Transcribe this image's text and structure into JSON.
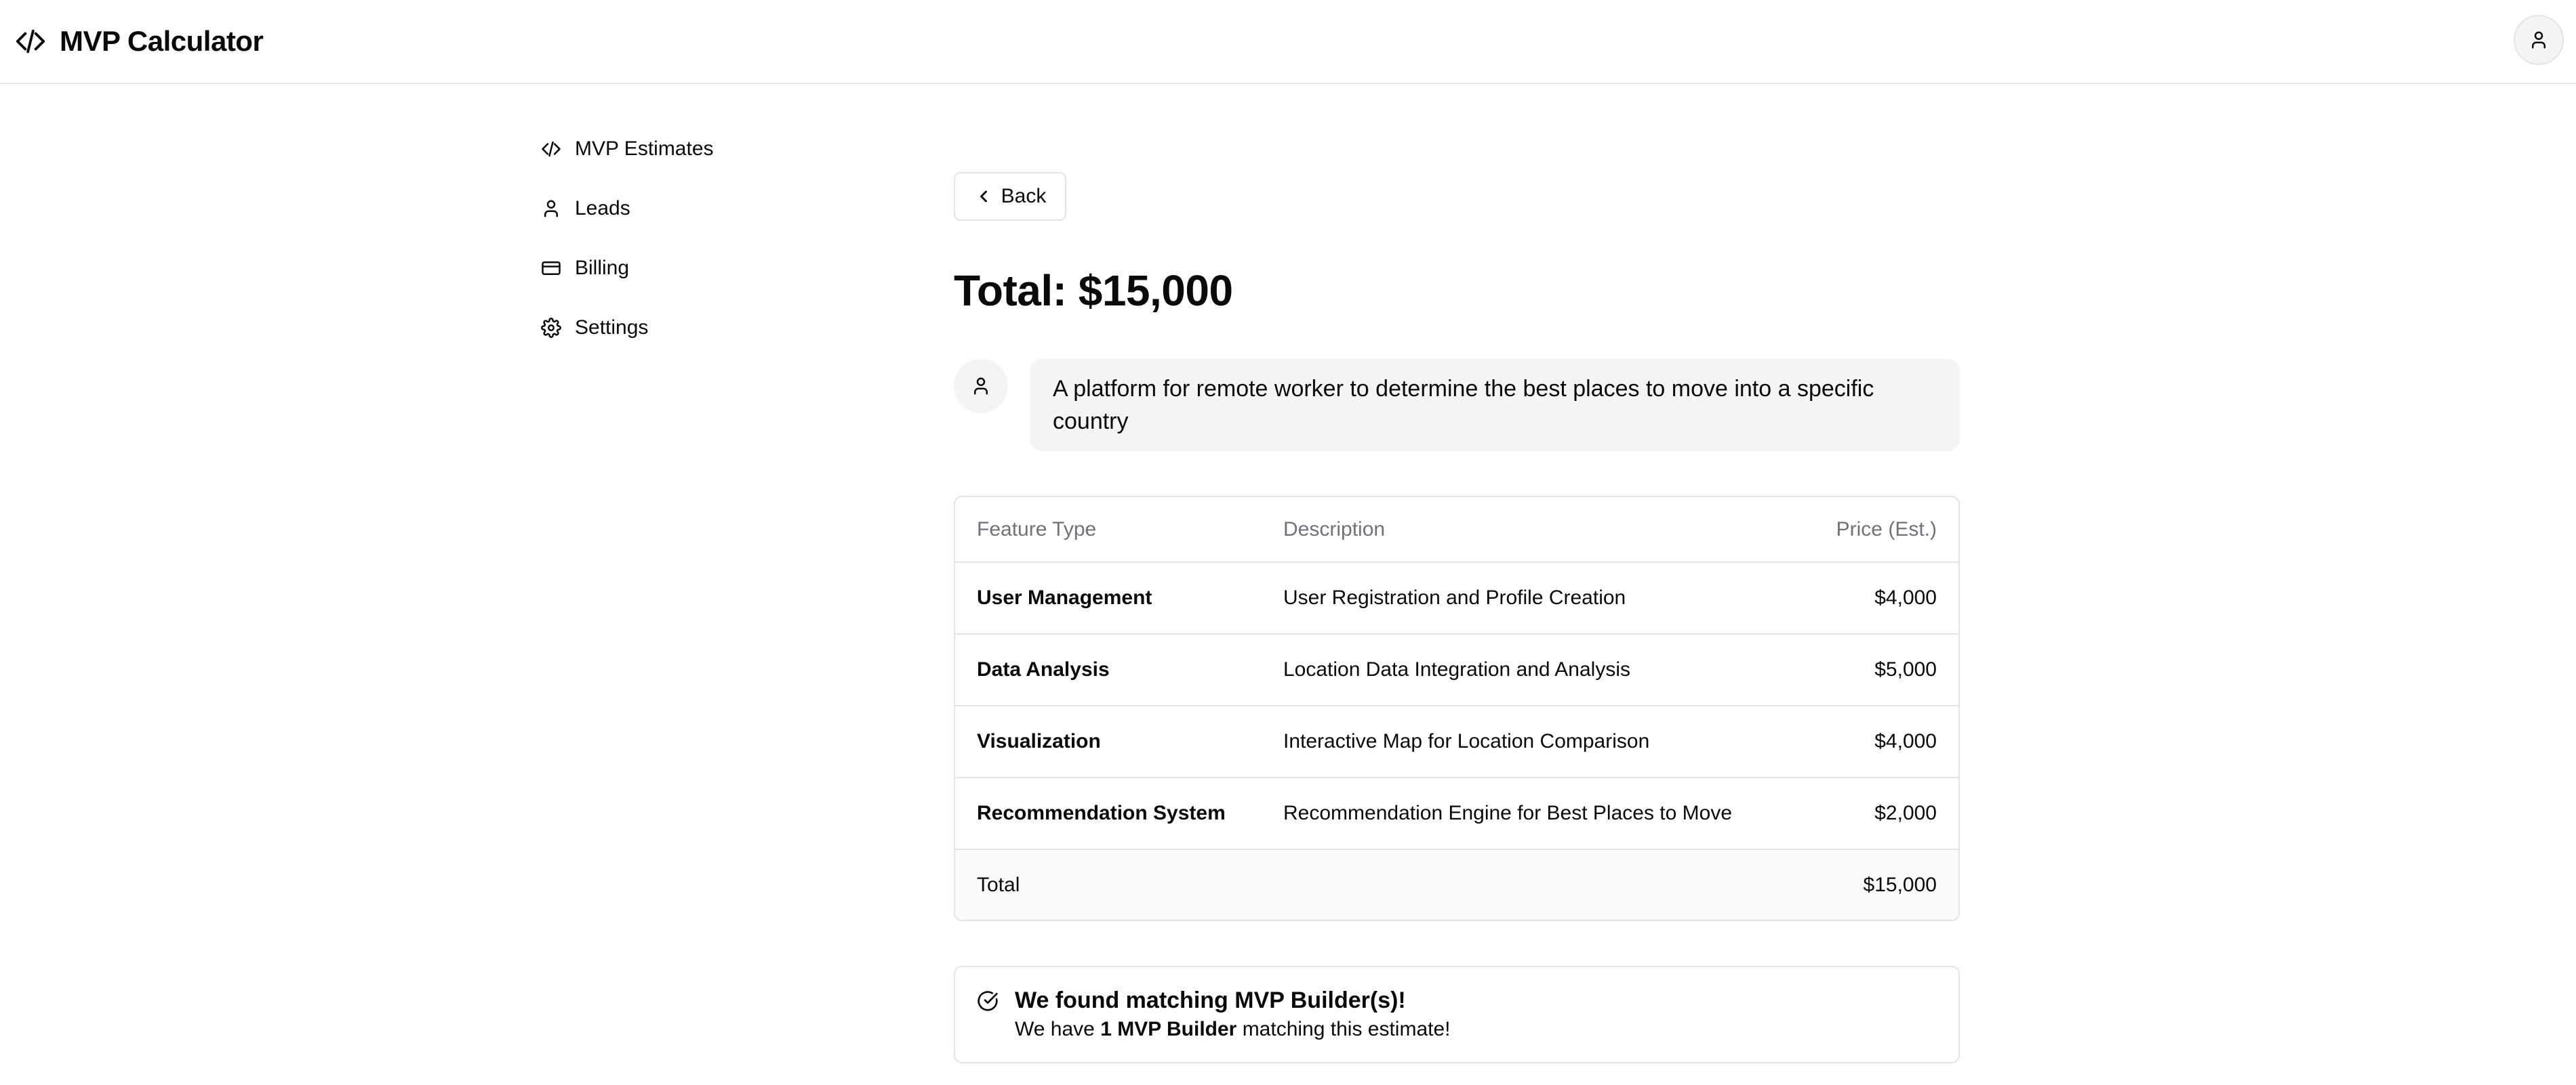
{
  "header": {
    "brand_title": "MVP Calculator",
    "brand_icon": "code-icon",
    "avatar_icon": "user-icon"
  },
  "sidebar": {
    "items": [
      {
        "label": "MVP Estimates",
        "icon": "code-icon"
      },
      {
        "label": "Leads",
        "icon": "user-icon"
      },
      {
        "label": "Billing",
        "icon": "credit-card-icon"
      },
      {
        "label": "Settings",
        "icon": "gear-icon"
      }
    ]
  },
  "main": {
    "back_label": "Back",
    "total_heading": "Total: $15,000",
    "prompt": "A platform for remote worker to determine the best places to move into a specific country",
    "table": {
      "headers": [
        "Feature Type",
        "Description",
        "Price (Est.)"
      ],
      "rows": [
        {
          "feature": "User Management",
          "description": "User Registration and Profile Creation",
          "price": "$4,000"
        },
        {
          "feature": "Data Analysis",
          "description": "Location Data Integration and Analysis",
          "price": "$5,000"
        },
        {
          "feature": "Visualization",
          "description": "Interactive Map for Location Comparison",
          "price": "$4,000"
        },
        {
          "feature": "Recommendation System",
          "description": "Recommendation Engine for Best Places to Move",
          "price": "$2,000"
        }
      ],
      "total_label": "Total",
      "total_value": "$15,000"
    },
    "match": {
      "title": "We found matching MVP Builder(s)!",
      "text_prefix": "We have ",
      "text_bold": "1 MVP Builder",
      "text_suffix": " matching this estimate!"
    }
  },
  "colors": {
    "border": "#e4e4e7",
    "muted_text": "#71717a",
    "surface": "#f4f4f5",
    "text": "#0a0a0a"
  }
}
